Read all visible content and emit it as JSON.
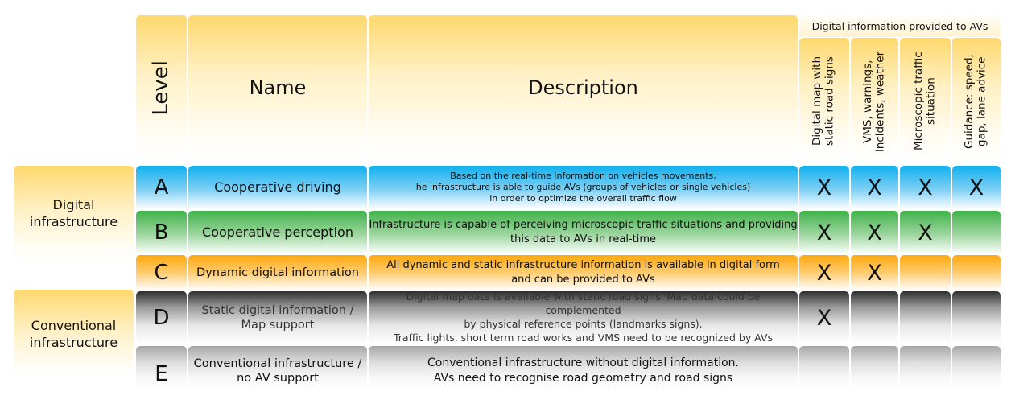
{
  "header": {
    "level": "Level",
    "name": "Name",
    "description": "Description",
    "digital_info_group": "Digital information provided to AVs",
    "info_columns": [
      "Digital map with static road signs",
      "VMS, warnings, incidents, weather",
      "Microscopic traffic situation",
      "Guidance: speed, gap, lane advice"
    ]
  },
  "groups": [
    {
      "label": "Digital infrastructure",
      "levels": [
        "A",
        "B",
        "C"
      ]
    },
    {
      "label": "Conventional infrastructure",
      "levels": [
        "D",
        "E"
      ]
    }
  ],
  "rows": [
    {
      "level": "A",
      "name": "Cooperative driving",
      "description": "Based on the real-time information on vehicles movements,\nhe infrastructure is able to guide AVs (groups of vehicles or single vehicles)\nin order to optimize the overall traffic flow",
      "color": "#0fb0ee",
      "marks": [
        "X",
        "X",
        "X",
        "X"
      ]
    },
    {
      "level": "B",
      "name": "Cooperative perception",
      "description": "Infrastructure is capable of perceiving microscopic traffic situations and providing\nthis data to AVs in real-time",
      "color": "#3fb24a",
      "marks": [
        "X",
        "X",
        "X",
        ""
      ]
    },
    {
      "level": "C",
      "name": "Dynamic digital information",
      "description": "All dynamic and static infrastructure information is available in digital form\nand can be provided to AVs",
      "color": "#ffa80e",
      "marks": [
        "X",
        "X",
        "",
        ""
      ]
    },
    {
      "level": "D",
      "name": "Static digital information /\nMap support",
      "description": "Digital map data is available with static road signs. Map data could be complemented\nby physical reference points (landmarks signs).\nTraffic lights, short term road works and VMS need to be recognized by AVs",
      "color": "#2e2e2e",
      "marks": [
        "X",
        "",
        "",
        ""
      ]
    },
    {
      "level": "E",
      "name": "Conventional infrastructure /\nno AV support",
      "description": "Conventional infrastructure without digital information.\nAVs need to recognise road geometry and road signs",
      "color": "#a6a6a6",
      "marks": [
        "",
        "",
        "",
        ""
      ]
    }
  ]
}
